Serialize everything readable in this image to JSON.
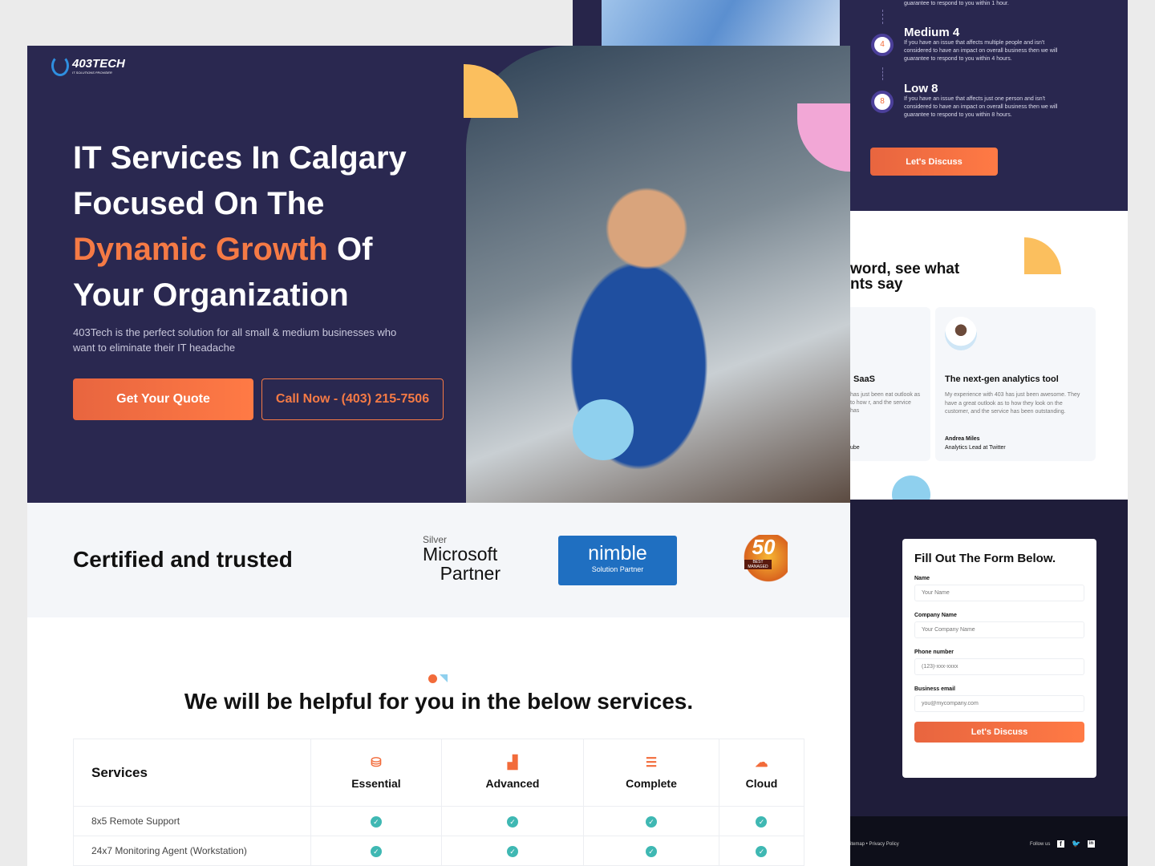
{
  "priority": {
    "partial_text": "guarantee to respond to you within 1 hour.",
    "levels": [
      {
        "title": "Medium 4",
        "number": "4",
        "text": "If you have an issue that affects multiple people and isn't considered to have an impact on overall business then we will guarantee to respond to you within 4 hours."
      },
      {
        "title": "Low 8",
        "number": "8",
        "text": "If you have an issue that affects just one person and isn't considered to have an impact on overall business then we will guarantee to respond to you within 8 hours."
      }
    ],
    "cta": "Let's Discuss"
  },
  "testimonials": {
    "heading_line1": "word, see what",
    "heading_line2": "nts say",
    "left_card": {
      "title": "SaaS",
      "text": "has just been eat outlook as to how r, and the service has",
      "role": "ube"
    },
    "card": {
      "title": "The next-gen analytics tool",
      "text": "My experience with 403 has just been awesome. They have a great outlook as to how they look on the customer, and the service has been outstanding.",
      "name": "Andrea Miles",
      "role": "Analytics Lead at Twitter"
    }
  },
  "form": {
    "title": "Fill Out The Form Below.",
    "fields": [
      {
        "label": "Name",
        "placeholder": "Your Name"
      },
      {
        "label": "Company Name",
        "placeholder": "Your Company Name"
      },
      {
        "label": "Phone number",
        "placeholder": "(123)-xxx-xxxx"
      },
      {
        "label": "Business email",
        "placeholder": "you@mycompany.com"
      }
    ],
    "submit": "Let's Discuss"
  },
  "footer": {
    "links": "itemap • Privacy Policy",
    "follow": "Follow us",
    "social": [
      "facebook-icon",
      "twitter-icon",
      "linkedin-icon"
    ]
  },
  "logo": {
    "name": "403TECH",
    "tagline": "IT SOLUTIONS PROVIDER"
  },
  "hero": {
    "line1": "IT Services In Calgary",
    "line2": "Focused On The",
    "accent": "Dynamic Growth",
    "line3_rest": " Of",
    "line4": "Your Organization",
    "subtitle": "403Tech is the perfect solution for all small & medium businesses who want to eliminate their IT headache",
    "primary_cta": "Get Your Quote",
    "secondary_cta": "Call Now - (403) 215-7506"
  },
  "certified": {
    "title": "Certified and trusted",
    "microsoft": {
      "tier": "Silver",
      "line1": "Microsoft",
      "line2": "Partner"
    },
    "nimble": {
      "name": "nimble",
      "sub": "Solution Partner"
    },
    "best_managed": {
      "number": "50",
      "label": "BEST MANAGED"
    }
  },
  "services": {
    "heading": "We will be helpful for you in the below services.",
    "header": "Services",
    "plans": [
      {
        "name": "Essential",
        "icon": "database-icon"
      },
      {
        "name": "Advanced",
        "icon": "building-icon"
      },
      {
        "name": "Complete",
        "icon": "server-icon"
      },
      {
        "name": "Cloud",
        "icon": "cloud-icon"
      }
    ],
    "rows": [
      "8x5 Remote Support",
      "24x7 Monitoring Agent (Workstation)"
    ]
  },
  "colors": {
    "navy": "#2a2850",
    "accent": "#f57a45",
    "check": "#3fb8b3"
  }
}
